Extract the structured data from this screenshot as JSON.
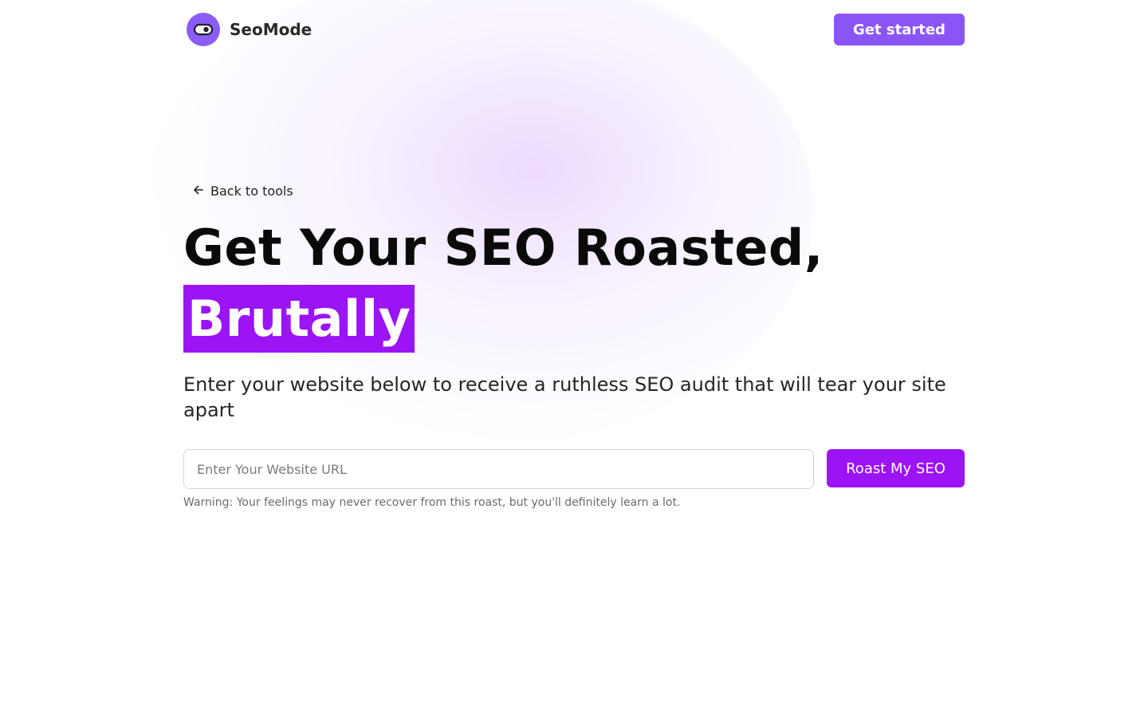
{
  "header": {
    "brand_name": "SeoMode",
    "cta_label": "Get started"
  },
  "hero": {
    "back_link": "Back to tools",
    "headline": "Get Your SEO Roasted,",
    "highlight": "Brutally",
    "subtitle": "Enter your website below to receive a ruthless SEO audit that will tear your site apart"
  },
  "form": {
    "url_value": "",
    "url_placeholder": "Enter Your Website URL",
    "submit_label": "Roast My SEO",
    "warning": "Warning: Your feelings may never recover from this roast, but you'll definitely learn a lot."
  },
  "colors": {
    "brand_purple": "#8b5cf6",
    "accent_purple": "#9b14f5"
  },
  "icons": {
    "logo": "toggle-eye-icon",
    "back": "arrow-left-icon"
  }
}
